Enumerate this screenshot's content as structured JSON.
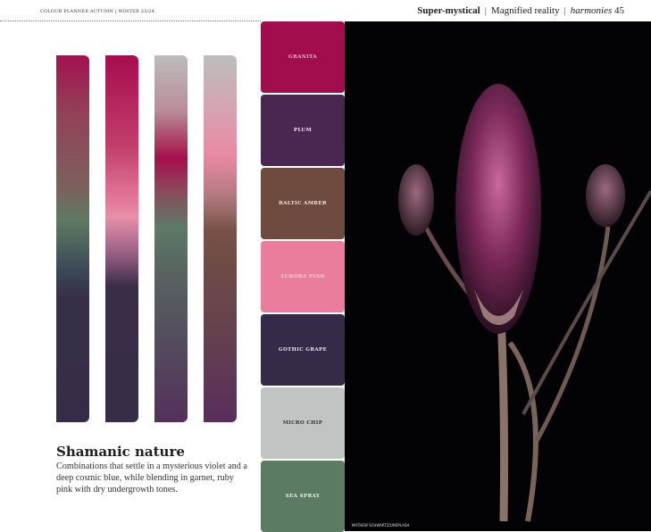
{
  "header": {
    "left": "COLOUR PLANNER  AUTUMN | WINTER 23/24",
    "section": "Super-mystical",
    "subsection": "Magnified reality",
    "category": "harmonies",
    "page_number": "45"
  },
  "article": {
    "title": "Shamanic nature",
    "description": "Combinations that settle in a mysterious violet and a deep cosmic blue, while blending in garnet, ruby pink with dry undergrowth tones."
  },
  "swatches": [
    {
      "name": "GRANITA",
      "color": "#a20d4e",
      "text_color": "#f3b8cf"
    },
    {
      "name": "PLUM",
      "color": "#4a2750",
      "text_color": "#f0e6f0"
    },
    {
      "name": "BALTIC AMBER",
      "color": "#6e4a3f",
      "text_color": "#f2e6df"
    },
    {
      "name": "AURORA PINK",
      "color": "#ea7c9c",
      "text_color": "#f7d0dc"
    },
    {
      "name": "GOTHIC GRAPE",
      "color": "#352a47",
      "text_color": "#eae4f0"
    },
    {
      "name": "MICRO CHIP",
      "color": "#c0c4c3",
      "text_color": "#333333"
    },
    {
      "name": "SEA SPRAY",
      "color": "#5c7b63",
      "text_color": "#eef3ee"
    }
  ],
  "photo": {
    "credit": "MATHEW SCHWARTZ/UNSPLASH"
  }
}
